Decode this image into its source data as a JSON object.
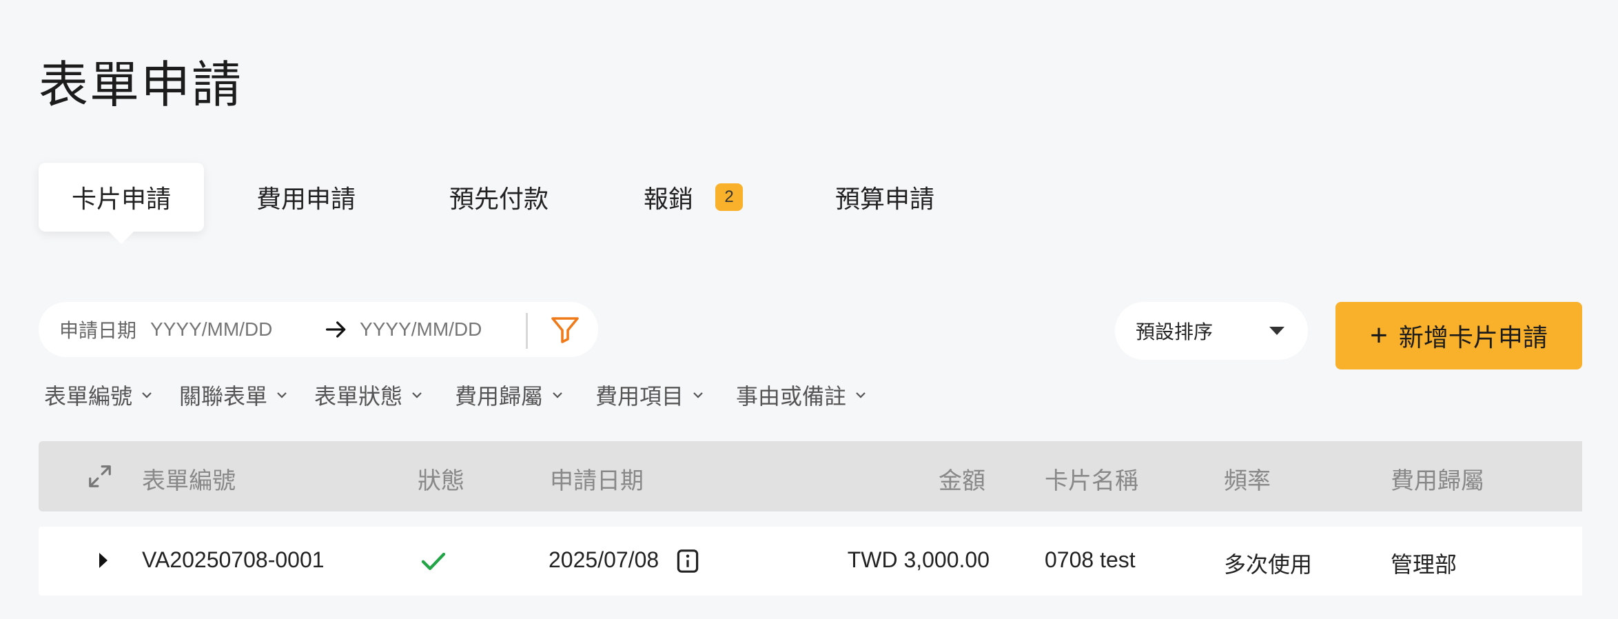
{
  "page": {
    "title": "表單申請"
  },
  "tabs": [
    {
      "label": "卡片申請",
      "active": true
    },
    {
      "label": "費用申請"
    },
    {
      "label": "預先付款"
    },
    {
      "label": "報銷",
      "badge": "2"
    },
    {
      "label": "預算申請"
    }
  ],
  "date_filter": {
    "label": "申請日期",
    "start_placeholder": "YYYY/MM/DD",
    "end_placeholder": "YYYY/MM/DD",
    "arrow_icon": "arrow-right-icon",
    "filter_icon": "filter-icon"
  },
  "sort": {
    "selected": "預設排序",
    "icon": "caret-down-icon"
  },
  "add_button": {
    "label": "新增卡片申請",
    "icon": "plus-icon"
  },
  "filters": [
    "表單編號",
    "關聯表單",
    "表單狀態",
    "費用歸屬",
    "費用項目",
    "事由或備註"
  ],
  "table": {
    "expand_icon": "expand-icon",
    "columns": [
      "表單編號",
      "狀態",
      "申請日期",
      "金額",
      "卡片名稱",
      "頻率",
      "費用歸屬"
    ],
    "rows": [
      {
        "form_no": "VA20250708-0001",
        "status_icon": "check-icon",
        "date": "2025/07/08",
        "amount": "TWD 3,000.00",
        "card_name": "0708 test",
        "frequency": "多次使用",
        "cost_owner": "管理部"
      }
    ]
  },
  "colors": {
    "accent": "#f9b02a",
    "filter_icon": "#f07a1a",
    "status_ok": "#22a447",
    "background": "#f6f7f9",
    "table_header": "#e1e1e1"
  }
}
